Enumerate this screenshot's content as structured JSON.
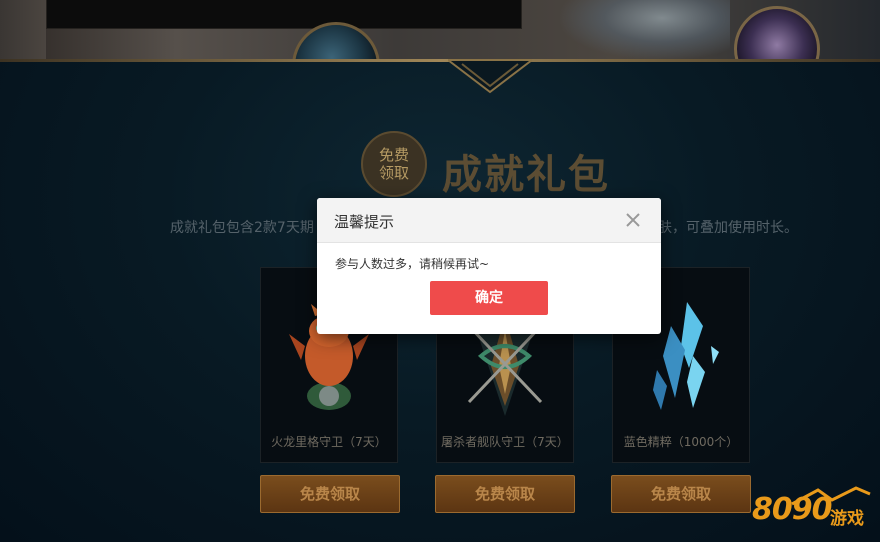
{
  "section": {
    "badge_line1": "免费",
    "badge_line2": "领取",
    "title": "成就礼包",
    "desc_left": "成就礼包包含2款7天期",
    "desc_right": "肤，可叠加使用时长。"
  },
  "items": [
    {
      "name": "火龙里格守卫（7天）",
      "button": "免费领取",
      "icon": "fire-dragon-ward-icon"
    },
    {
      "name": "屠杀者舰队守卫（7天）",
      "button": "免费领取",
      "icon": "slaughter-fleet-ward-icon"
    },
    {
      "name": "蓝色精粹（1000个）",
      "button": "免费领取",
      "icon": "blue-essence-icon"
    }
  ],
  "modal": {
    "title": "温馨提示",
    "message": "参与人数过多，请稍候再试~",
    "confirm": "确定",
    "close_icon": "close-icon"
  },
  "watermark": {
    "digits": "8090",
    "text": "游戏"
  },
  "colors": {
    "accent_red": "#ef4b4b",
    "gold": "#a08758",
    "logo_orange": "#e99a1a"
  }
}
